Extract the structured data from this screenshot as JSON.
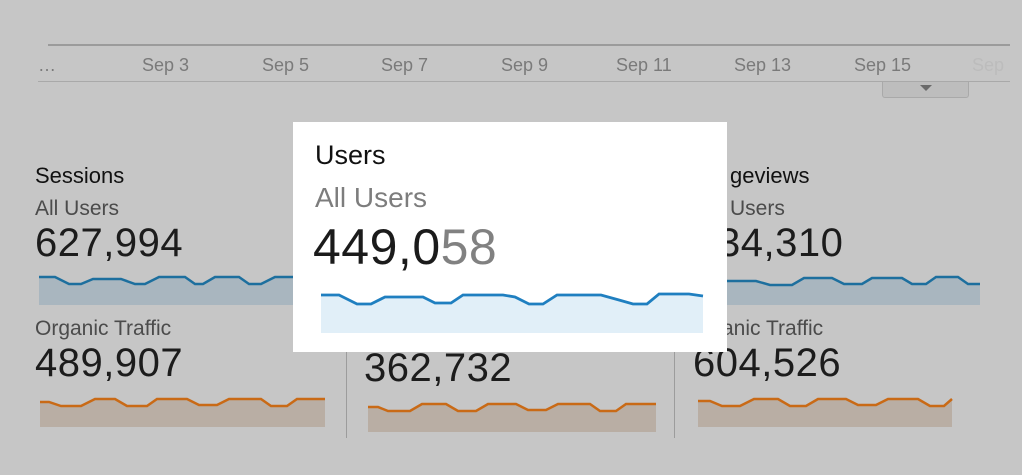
{
  "timeline": {
    "ticks": [
      "…",
      "Sep 3",
      "Sep 5",
      "Sep 7",
      "Sep 9",
      "Sep 11",
      "Sep 13",
      "Sep 15",
      "Sep"
    ]
  },
  "metrics": {
    "sessions": {
      "title": "Sessions",
      "all_users_label": "All Users",
      "all_users_value": "627,994",
      "organic_label": "Organic Traffic",
      "organic_value": "489,907"
    },
    "users": {
      "organic_value": "362,732"
    },
    "pageviews": {
      "title": "geviews",
      "all_users_label": "Users",
      "all_users_value": "34,310",
      "organic_label": "anic Traffic",
      "organic_value": "604,526"
    }
  },
  "popup": {
    "title": "Users",
    "segment_label": "All Users",
    "value_prefix": "449,0",
    "value_obscured": "58"
  },
  "colors": {
    "background": "#c6c6c6",
    "blue_line": "#1f7fc0",
    "blue_fill": "#e1eff8",
    "orange_line": "#d9741d",
    "orange_fill": "#d8b9a0",
    "popup_bg": "#ffffff"
  }
}
